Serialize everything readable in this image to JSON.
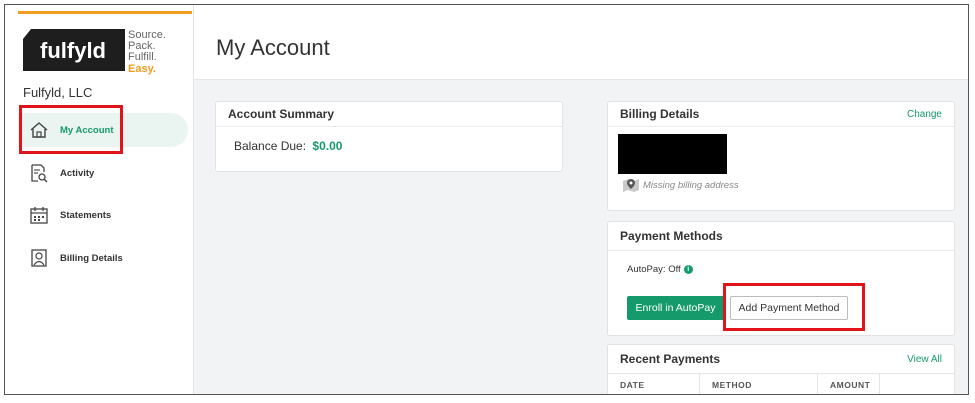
{
  "logo": {
    "word": "fulfyld",
    "tag1": "Source.",
    "tag2": "Pack.",
    "tag3": "Fulfill.",
    "tag4": "Easy."
  },
  "company": "Fulfyld, LLC",
  "colors": {
    "accent_green": "#159a6b",
    "accent_orange": "#f39c1f",
    "highlight_red": "#e0151b"
  },
  "sidebar": {
    "items": [
      {
        "label": "My Account",
        "icon": "home-icon",
        "active": true
      },
      {
        "label": "Activity",
        "icon": "activity-icon",
        "active": false
      },
      {
        "label": "Statements",
        "icon": "calendar-icon",
        "active": false
      },
      {
        "label": "Billing Details",
        "icon": "person-icon",
        "active": false
      }
    ]
  },
  "page": {
    "title": "My Account"
  },
  "account_summary": {
    "title": "Account Summary",
    "balance_label": "Balance Due:",
    "balance_value": "$0.00"
  },
  "billing_details": {
    "title": "Billing Details",
    "change_label": "Change",
    "missing_address": "Missing billing address"
  },
  "payment_methods": {
    "title": "Payment Methods",
    "autopay_status": "AutoPay: Off",
    "info_glyph": "i",
    "enroll_label": "Enroll in AutoPay",
    "add_label": "Add Payment Method"
  },
  "recent_payments": {
    "title": "Recent Payments",
    "view_all_label": "View All",
    "columns": [
      "DATE",
      "METHOD",
      "AMOUNT",
      ""
    ]
  }
}
